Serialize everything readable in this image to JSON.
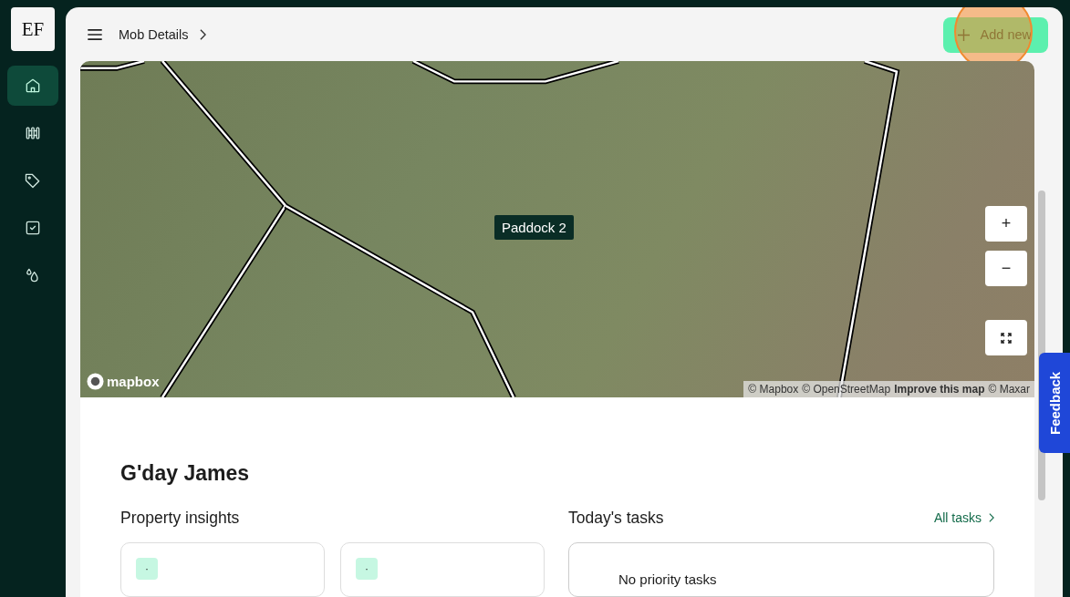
{
  "logo": {
    "text": "EF"
  },
  "sidebar": {
    "items": [
      {
        "selected": true
      },
      {
        "selected": false
      },
      {
        "selected": false
      },
      {
        "selected": false
      },
      {
        "selected": false
      }
    ]
  },
  "header": {
    "breadcrumb": "Mob Details",
    "add_button": {
      "label": "Add new",
      "highlighted": true
    }
  },
  "map": {
    "paddock_label": "Paddock 2",
    "logo_text": "mapbox",
    "attribution": [
      "© Mapbox",
      "© OpenStreetMap",
      "Improve this map",
      "© Maxar"
    ],
    "controls": [
      "+",
      "−"
    ]
  },
  "feedback": "Feedback",
  "greeting": "G'day James",
  "insights": {
    "title": "Property insights",
    "cards": [
      {
        "icon": "·"
      },
      {
        "icon": "·"
      }
    ]
  },
  "tasks": {
    "title": "Today's tasks",
    "link": "All tasks",
    "empty": "No priority tasks"
  }
}
